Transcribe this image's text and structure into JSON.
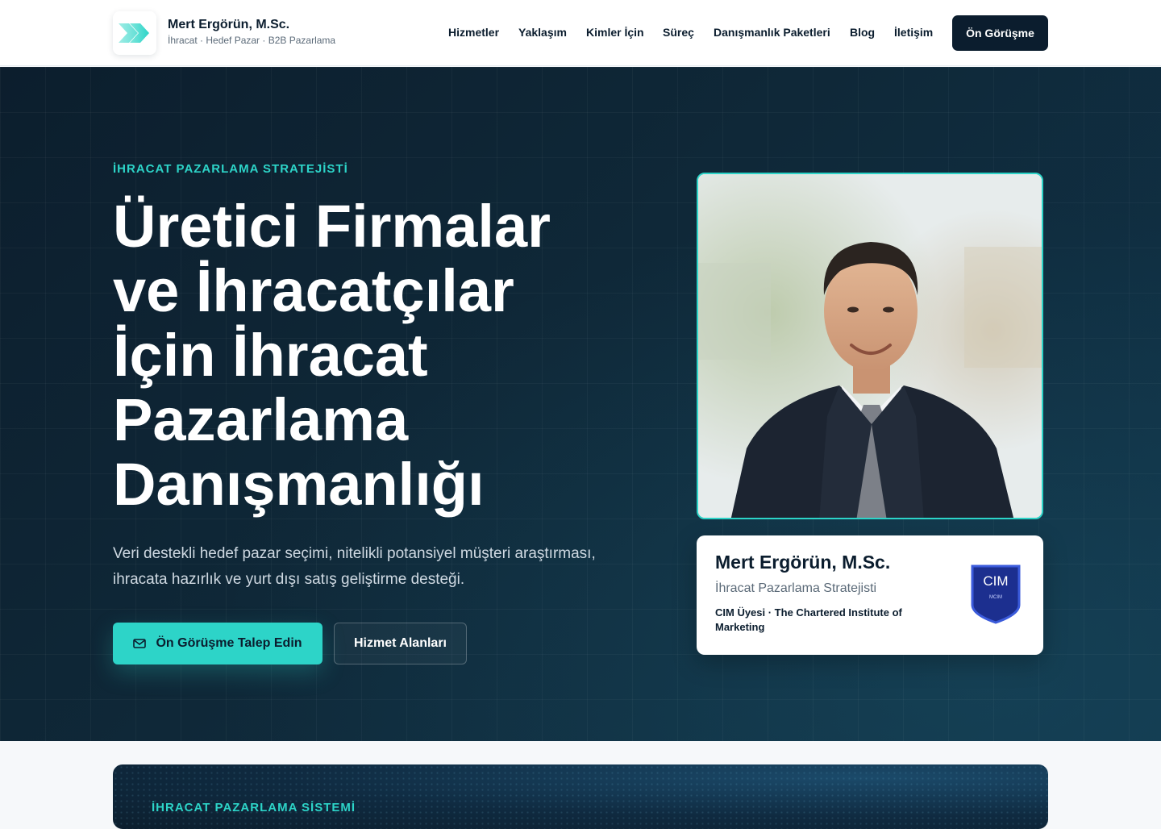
{
  "brand": {
    "name": "Mert Ergörün, M.Sc.",
    "tagline": "İhracat · Hedef Pazar · B2B Pazarlama",
    "accent_color": "#2dd4c8",
    "dark_color": "#0b1d2e"
  },
  "nav": {
    "items": [
      {
        "label": "Hizmetler"
      },
      {
        "label": "Yaklaşım"
      },
      {
        "label": "Kimler İçin"
      },
      {
        "label": "Süreç"
      },
      {
        "label": "Danışmanlık Paketleri"
      },
      {
        "label": "Blog"
      },
      {
        "label": "İletişim"
      }
    ],
    "cta_label": "Ön Görüşme"
  },
  "hero": {
    "eyebrow": "İHRACAT PAZARLAMA STRATEJİSTİ",
    "title": "Üretici Firmalar ve İhracatçılar İçin İhracat Pazarlama Danışmanlığı",
    "subtitle": "Veri destekli hedef pazar seçimi, nitelikli potansiyel müşteri araştırması, ihracata hazırlık ve yurt dışı satış geliştirme desteği.",
    "primary_button": "Ön Görüşme Talep Edin",
    "primary_icon": "mail-icon",
    "secondary_button": "Hizmet Alanları"
  },
  "profile_card": {
    "name": "Mert Ergörün, M.Sc.",
    "role": "İhracat Pazarlama Stratejisti",
    "membership": "CIM Üyesi · The Chartered Institute of Marketing",
    "badge_text": "CIM",
    "badge_subtext": "MCIM"
  },
  "next_section": {
    "eyebrow": "İHRACAT PAZARLAMA SİSTEMİ"
  }
}
